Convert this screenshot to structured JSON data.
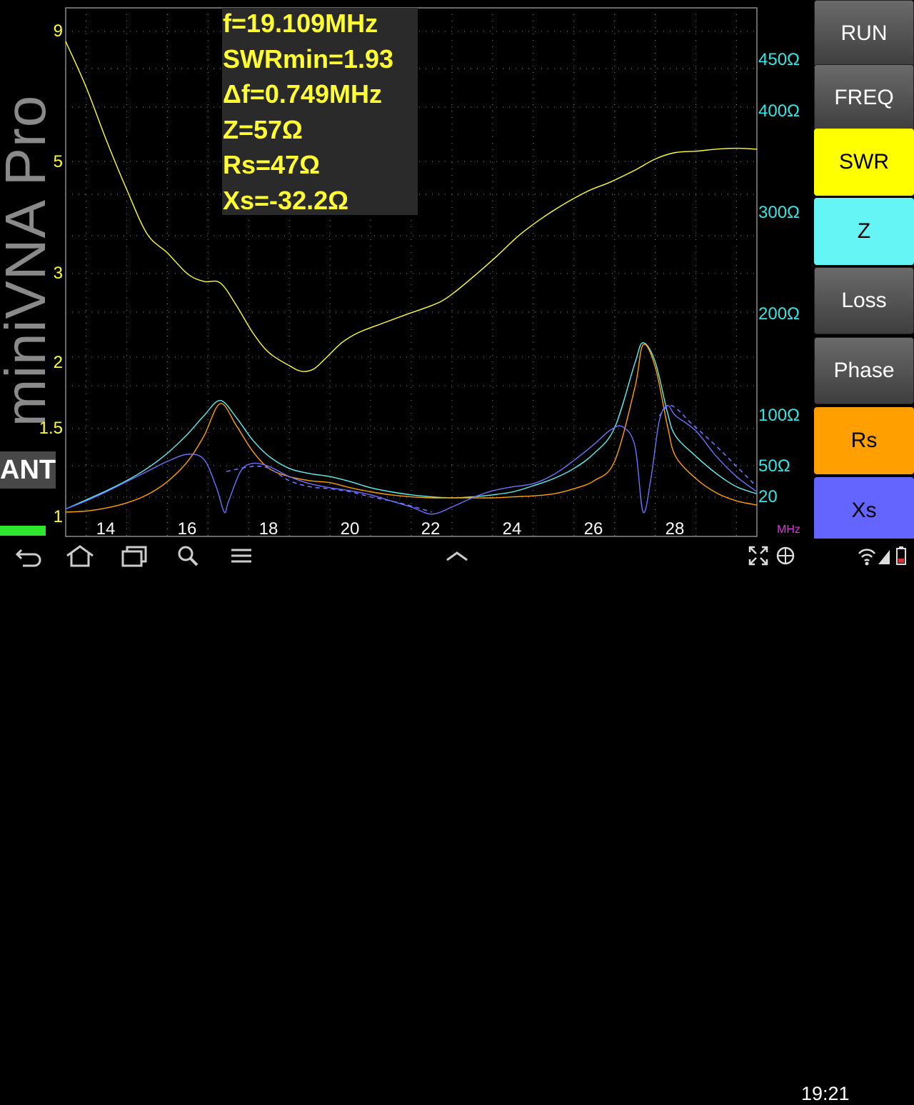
{
  "app": {
    "brand": "miniVNA Pro",
    "port_label": "ANT"
  },
  "readout": {
    "freq": "f=19.109MHz",
    "swr_min": "SWRmin=1.93",
    "delta_f": "Δf=0.749MHz",
    "z": "Z=57Ω",
    "rs": "Rs=47Ω",
    "xs": "Xs=-32.2Ω"
  },
  "axes": {
    "swr_ticks": [
      "9",
      "5",
      "3",
      "2",
      "1.5",
      "1"
    ],
    "ohm_ticks": [
      "450Ω",
      "400Ω",
      "300Ω",
      "200Ω",
      "100Ω",
      "50Ω",
      "20"
    ],
    "freq_ticks": [
      "14",
      "16",
      "18",
      "20",
      "22",
      "24",
      "26",
      "28"
    ],
    "freq_unit": "MHz"
  },
  "buttons": {
    "run": "RUN",
    "freq": "FREQ",
    "swr": "SWR",
    "z": "Z",
    "loss": "Loss",
    "phase": "Phase",
    "rs": "Rs",
    "xs": "Xs"
  },
  "colors": {
    "swr": "#ffff33",
    "z": "#5ff2f2",
    "rs": "#ffa000",
    "xs": "#7070ff",
    "grid": "#8a8a8a"
  },
  "status_bar": {
    "time": "19:21"
  },
  "chart_data": {
    "type": "line",
    "xlabel": "MHz",
    "xlim": [
      13,
      30
    ],
    "x_ticks": [
      14,
      16,
      18,
      20,
      22,
      24,
      26,
      28
    ],
    "y_left": {
      "label": "",
      "scale": "log",
      "ticks": [
        1,
        1.5,
        2,
        3,
        5,
        9
      ],
      "ylim": [
        1,
        10
      ]
    },
    "y_right": {
      "label": "",
      "ticks": [
        20,
        50,
        100,
        200,
        300,
        400,
        450
      ],
      "ylim": [
        0,
        500
      ]
    },
    "series": [
      {
        "name": "SWR",
        "axis": "left",
        "x": [
          13.0,
          13.5,
          14.0,
          14.5,
          15.0,
          15.5,
          16.0,
          16.4,
          16.8,
          17.2,
          17.6,
          18.0,
          18.5,
          18.8,
          19.1,
          19.4,
          19.8,
          20.2,
          20.8,
          21.4,
          22.0,
          22.4,
          23.0,
          23.6,
          24.2,
          25.0,
          25.8,
          26.4,
          27.0,
          27.5,
          28.0,
          28.5,
          29.0,
          29.5,
          30.0
        ],
        "y": [
          8.6,
          7.0,
          5.5,
          4.4,
          3.6,
          3.3,
          3.0,
          2.9,
          2.88,
          2.6,
          2.3,
          2.1,
          1.98,
          1.93,
          1.95,
          2.05,
          2.2,
          2.3,
          2.4,
          2.5,
          2.6,
          2.7,
          2.95,
          3.25,
          3.6,
          4.0,
          4.35,
          4.55,
          4.8,
          5.05,
          5.2,
          5.23,
          5.28,
          5.3,
          5.28
        ]
      },
      {
        "name": "Z",
        "axis": "right",
        "x": [
          13.0,
          13.5,
          14.0,
          14.5,
          15.0,
          15.5,
          16.0,
          16.4,
          16.8,
          17.2,
          17.6,
          18.0,
          18.5,
          19.0,
          19.5,
          20.0,
          20.5,
          21.0,
          21.5,
          22.0,
          22.5,
          23.0,
          23.5,
          24.0,
          24.5,
          25.0,
          25.5,
          26.0,
          26.5,
          27.0,
          27.2,
          27.5,
          27.8,
          28.0,
          28.5,
          29.0,
          29.5,
          30.0
        ],
        "y": [
          8,
          17,
          26,
          36,
          48,
          63,
          82,
          100,
          115,
          98,
          76,
          60,
          48,
          43,
          40,
          35,
          29,
          25,
          22,
          20,
          19,
          20,
          22,
          25,
          31,
          38,
          48,
          63,
          88,
          152,
          172,
          153,
          103,
          80,
          60,
          43,
          30,
          23
        ]
      },
      {
        "name": "Rs",
        "axis": "right",
        "x": [
          13.0,
          13.5,
          14.0,
          14.5,
          15.0,
          15.5,
          16.0,
          16.4,
          16.8,
          17.2,
          17.6,
          18.0,
          18.5,
          19.0,
          19.5,
          20.0,
          20.5,
          21.0,
          21.5,
          22.0,
          22.5,
          23.0,
          23.5,
          24.0,
          24.5,
          25.0,
          25.5,
          26.0,
          26.5,
          27.0,
          27.2,
          27.5,
          27.8,
          28.0,
          28.5,
          29.0,
          29.5,
          30.0
        ],
        "y": [
          5,
          6,
          9,
          14,
          22,
          35,
          55,
          80,
          112,
          90,
          65,
          48,
          40,
          36,
          34,
          29,
          25,
          22,
          20,
          19,
          19,
          19,
          19,
          20,
          21,
          23,
          28,
          36,
          55,
          128,
          170,
          148,
          90,
          60,
          38,
          24,
          16,
          12
        ]
      },
      {
        "name": "Xs",
        "axis": "right",
        "x": [
          13.0,
          13.5,
          14.0,
          14.5,
          15.0,
          15.5,
          16.0,
          16.4,
          16.7,
          16.9,
          17.0,
          17.3,
          17.6,
          18.0,
          18.5,
          19.0,
          19.5,
          20.0,
          20.5,
          21.0,
          21.5,
          22.0,
          22.5,
          23.0,
          23.5,
          24.0,
          24.5,
          25.0,
          25.5,
          26.0,
          26.4,
          26.7,
          27.0,
          27.2,
          27.4,
          27.6,
          27.8,
          28.0,
          28.5,
          29.0,
          29.5,
          30.0
        ],
        "y": [
          8,
          16,
          25,
          35,
          45,
          55,
          62,
          57,
          30,
          5,
          15,
          45,
          53,
          50,
          40,
          33,
          29,
          26,
          22,
          16,
          10,
          3,
          10,
          19,
          26,
          30,
          33,
          42,
          56,
          72,
          86,
          89,
          70,
          5,
          40,
          95,
          110,
          100,
          85,
          60,
          40,
          25
        ]
      }
    ]
  }
}
